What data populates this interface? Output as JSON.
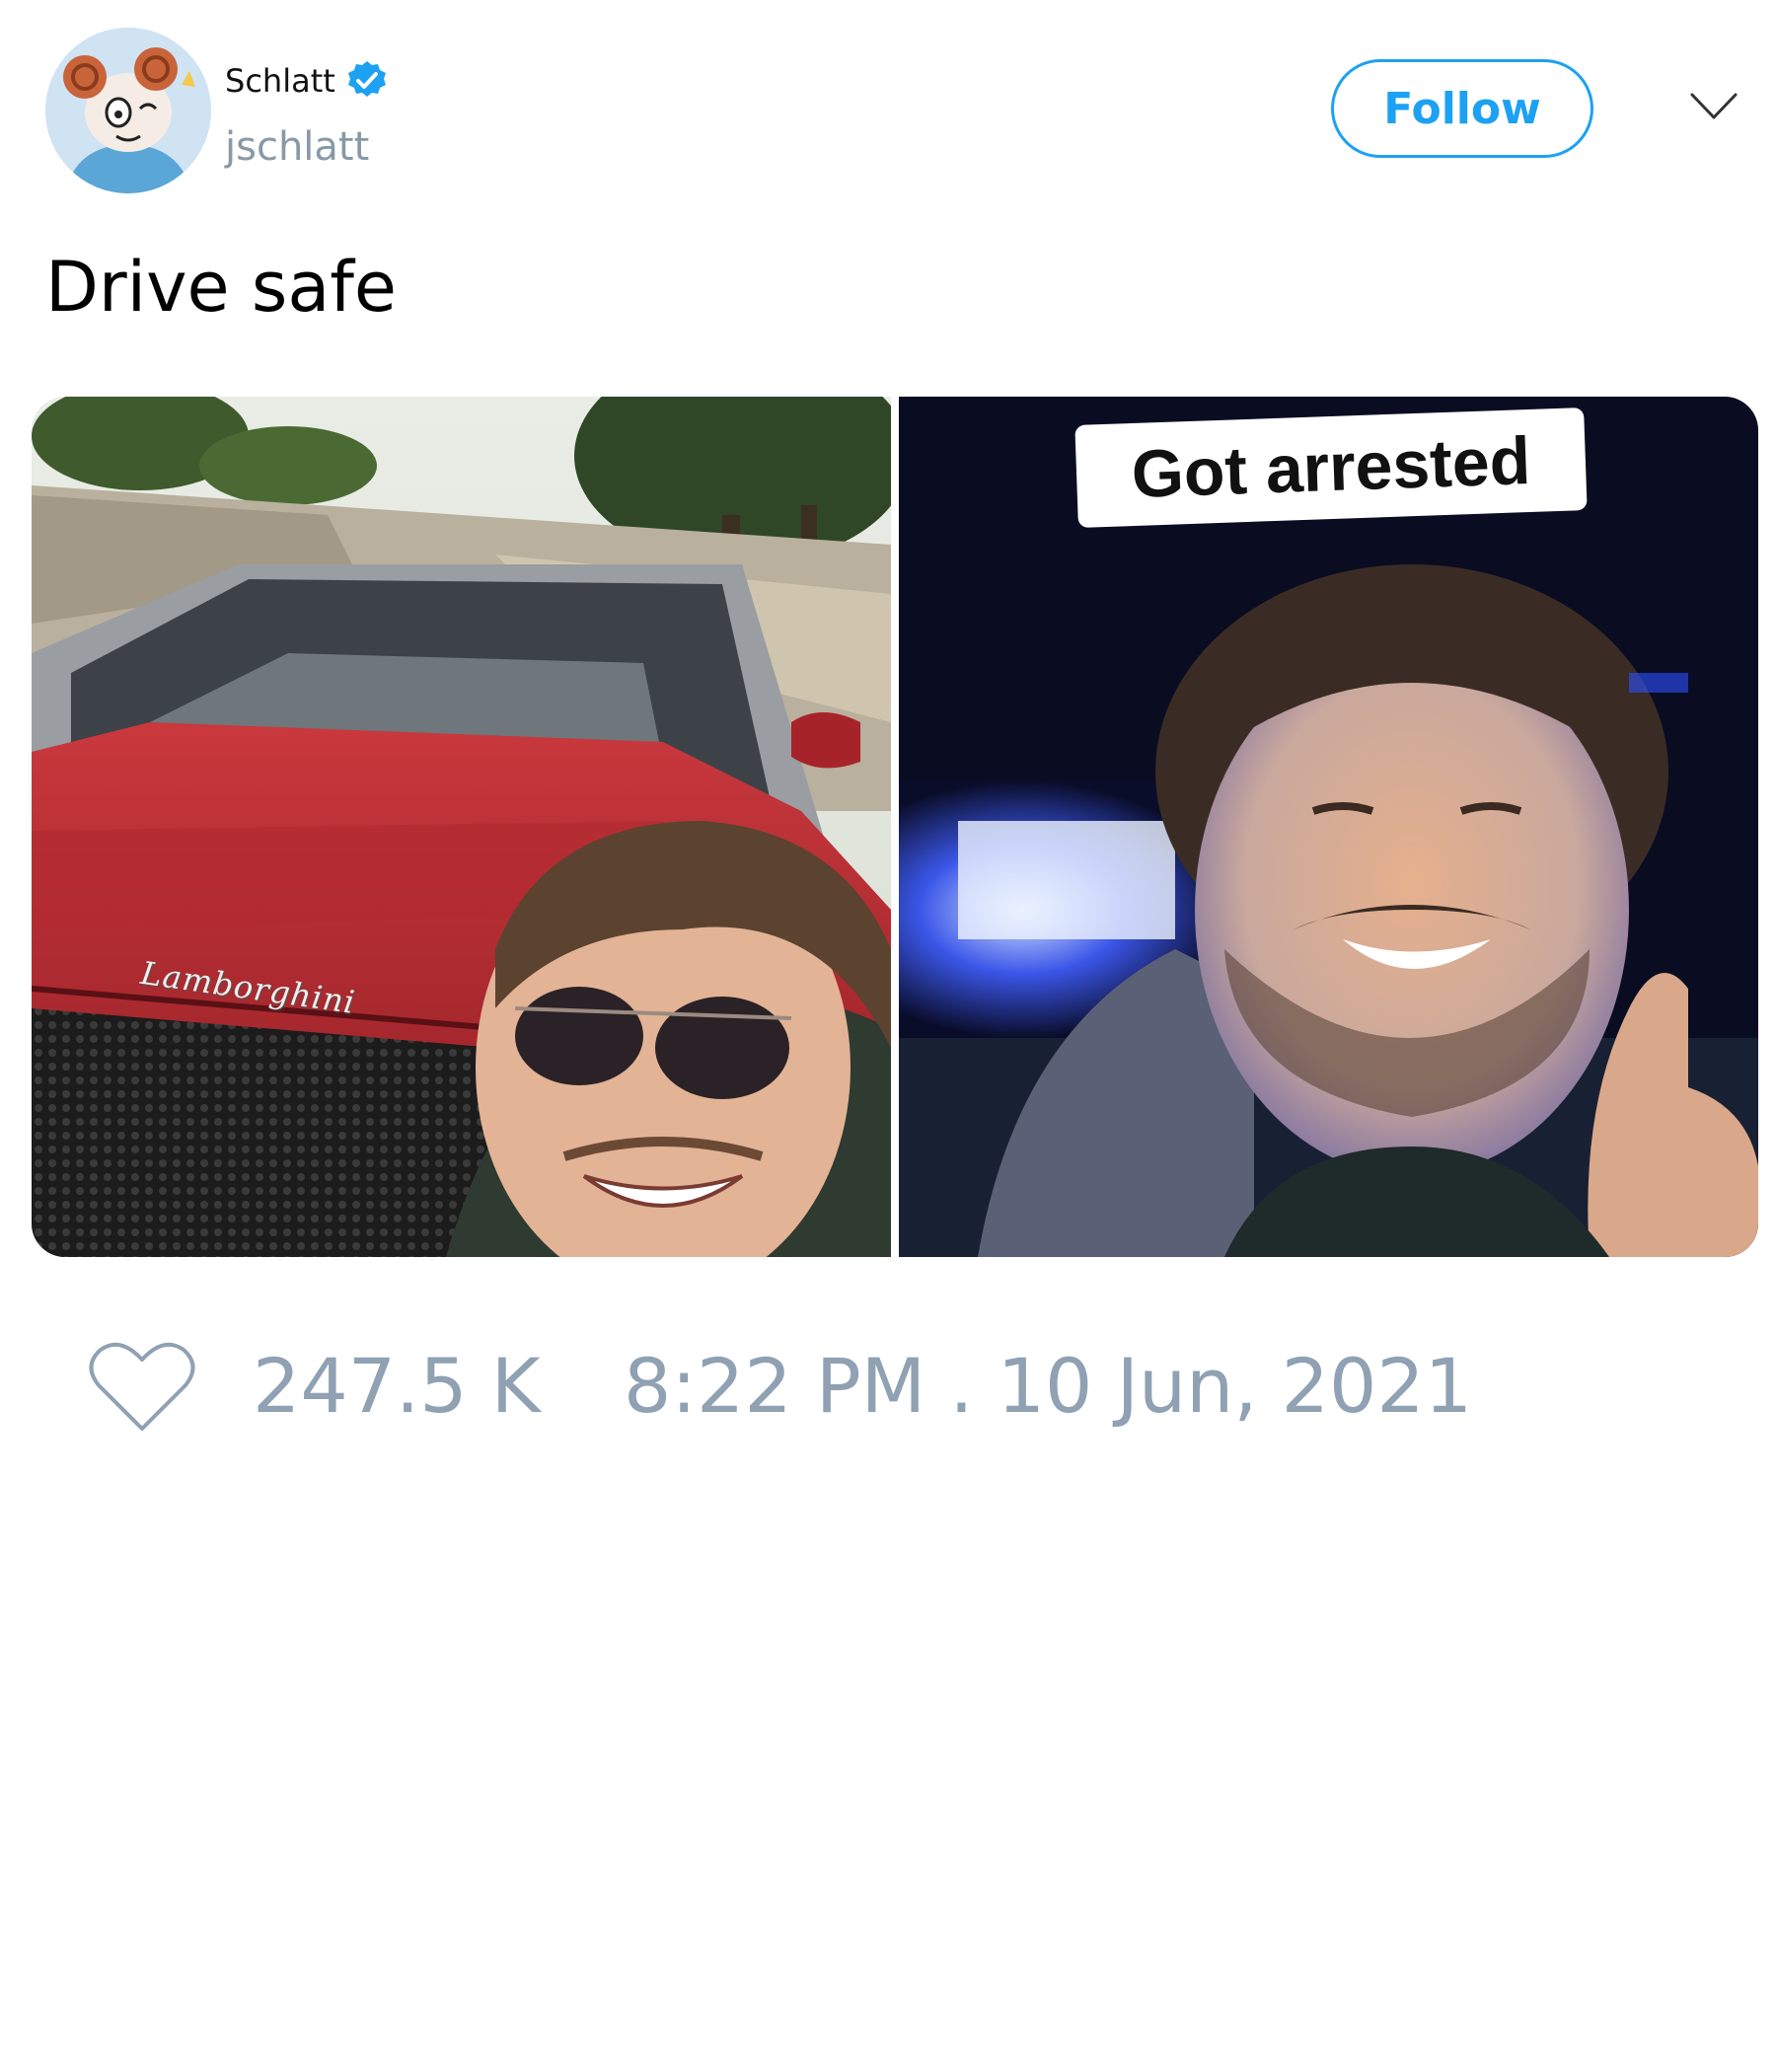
{
  "user": {
    "display_name": "Schlatt",
    "handle": "jschlatt",
    "verified": true,
    "avatar_icon": "cartoon-ram-avatar"
  },
  "header": {
    "follow_label": "Follow",
    "menu_icon": "chevron-down-icon"
  },
  "tweet": {
    "text": "Drive safe"
  },
  "media": {
    "left_photo": "selfie-with-red-lamborghini",
    "left_logo_text": "Lamborghini",
    "right_photo": "selfie-in-police-car",
    "right_caption": "Got arrested"
  },
  "footer": {
    "like_icon": "heart-icon",
    "likes": "247.5 K",
    "timestamp": "8:22 PM . 10 Jun, 2021"
  },
  "colors": {
    "accent": "#1da1f2",
    "muted_text": "#8fa1b3",
    "handle_text": "#8899a6"
  }
}
